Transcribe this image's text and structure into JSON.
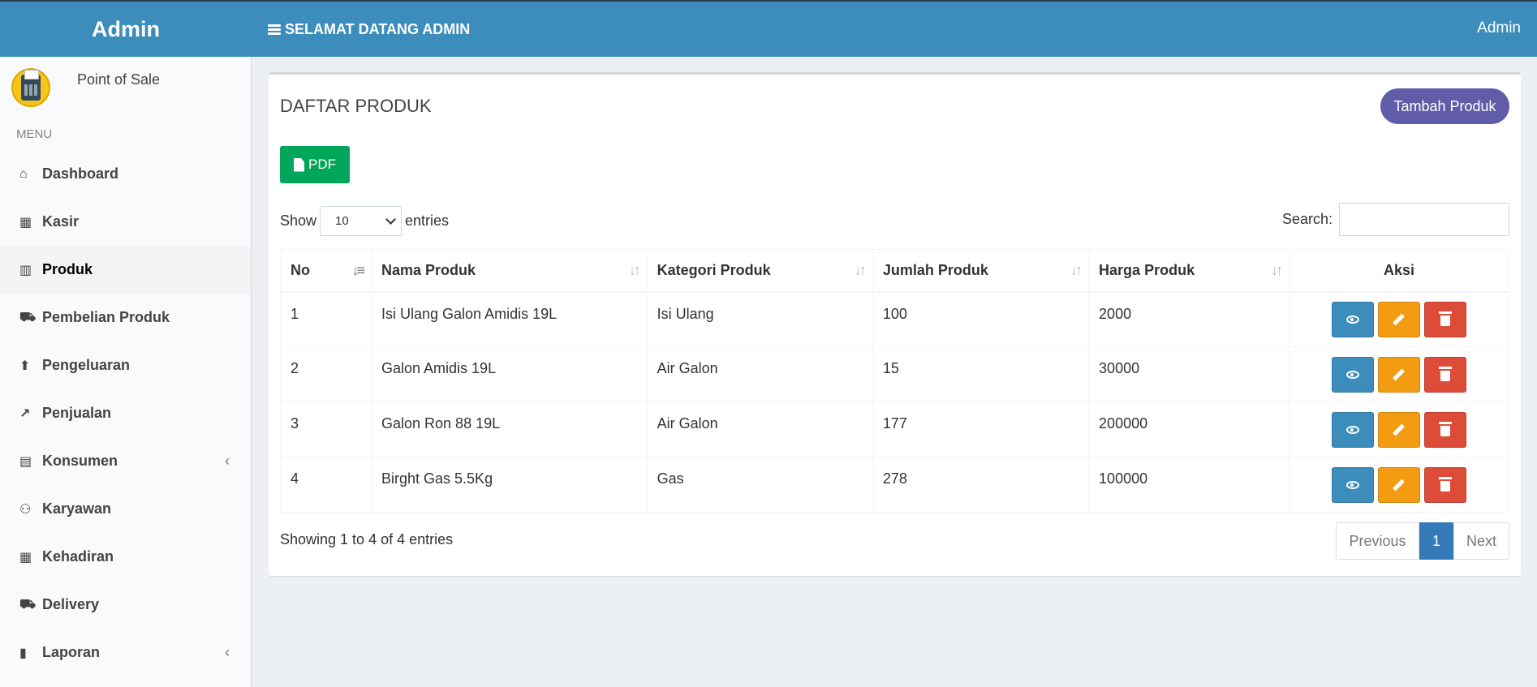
{
  "header": {
    "brand": "Admin",
    "welcome": "SELAMAT DATANG ADMIN",
    "user": "Admin"
  },
  "sidebar": {
    "user_panel": "Point of Sale",
    "menu_header": "MENU",
    "items": [
      {
        "label": "Dashboard",
        "icon": "home-icon"
      },
      {
        "label": "Kasir",
        "icon": "calculator-icon"
      },
      {
        "label": "Produk",
        "icon": "bar-chart-icon",
        "active": true
      },
      {
        "label": "Pembelian Produk",
        "icon": "cart-icon"
      },
      {
        "label": "Pengeluaran",
        "icon": "arrow-circle-up-icon"
      },
      {
        "label": "Penjualan",
        "icon": "line-chart-icon"
      },
      {
        "label": "Konsumen",
        "icon": "building-icon",
        "expandable": true
      },
      {
        "label": "Karyawan",
        "icon": "users-icon"
      },
      {
        "label": "Kehadiran",
        "icon": "calendar-icon"
      },
      {
        "label": "Delivery",
        "icon": "cart-icon"
      },
      {
        "label": "Laporan",
        "icon": "file-icon",
        "expandable": true
      }
    ]
  },
  "main": {
    "title": "DAFTAR PRODUK",
    "add_button": "Tambah Produk",
    "pdf_button": "PDF",
    "length": {
      "show": "Show",
      "value": "10",
      "entries": "entries"
    },
    "search_label": "Search:",
    "columns": [
      "No",
      "Nama Produk",
      "Kategori Produk",
      "Jumlah Produk",
      "Harga Produk",
      "Aksi"
    ],
    "rows": [
      [
        "1",
        "Isi Ulang Galon Amidis 19L",
        "Isi Ulang",
        "100",
        "2000"
      ],
      [
        "2",
        "Galon Amidis 19L",
        "Air Galon",
        "15",
        "30000"
      ],
      [
        "3",
        "Galon Ron 88 19L",
        "Air Galon",
        "177",
        "200000"
      ],
      [
        "4",
        "Birght Gas 5.5Kg",
        "Gas",
        "278",
        "100000"
      ]
    ],
    "info": "Showing 1 to 4 of 4 entries",
    "pagination": {
      "previous": "Previous",
      "current": "1",
      "next": "Next"
    }
  },
  "colors": {
    "header": "#3c8dbc",
    "add_button": "#605ca8",
    "pdf_button": "#00a65a",
    "view": "#3c8dbc",
    "edit": "#f39c12",
    "delete": "#dd4b39"
  }
}
